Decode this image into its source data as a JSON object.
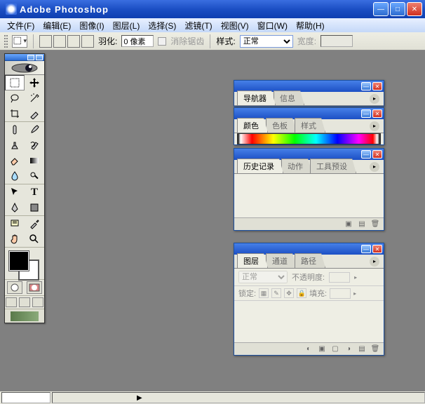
{
  "app": {
    "title": "Adobe Photoshop"
  },
  "menu": {
    "file": "文件(F)",
    "edit": "编辑(E)",
    "image": "图像(I)",
    "layer": "图层(L)",
    "select": "选择(S)",
    "filter": "滤镜(T)",
    "view": "视图(V)",
    "window": "窗口(W)",
    "help": "帮助(H)"
  },
  "options": {
    "feather_label": "羽化:",
    "feather_value": "0 像素",
    "antialias_label": "消除锯齿",
    "style_label": "样式:",
    "style_value": "正常",
    "width_label": "宽度:",
    "width_value": ""
  },
  "panels": {
    "navigator": {
      "tabs": [
        "导航器",
        "信息"
      ],
      "active": 0
    },
    "color": {
      "tabs": [
        "颜色",
        "色板",
        "样式"
      ],
      "active": 0
    },
    "history": {
      "tabs": [
        "历史记录",
        "动作",
        "工具预设"
      ],
      "active": 0
    },
    "layers": {
      "tabs": [
        "图层",
        "通道",
        "路径"
      ],
      "active": 0,
      "blend_mode": "正常",
      "opacity_label": "不透明度:",
      "opacity_value": "",
      "lock_label": "锁定:",
      "fill_label": "填充:",
      "fill_value": ""
    }
  },
  "colors": {
    "foreground": "#000000",
    "background": "#ffffff",
    "titlebar_gradient": "#1c4fc4",
    "panel_bg": "#e6e6dc"
  },
  "statusbar": {
    "zoom": "",
    "info": ""
  }
}
